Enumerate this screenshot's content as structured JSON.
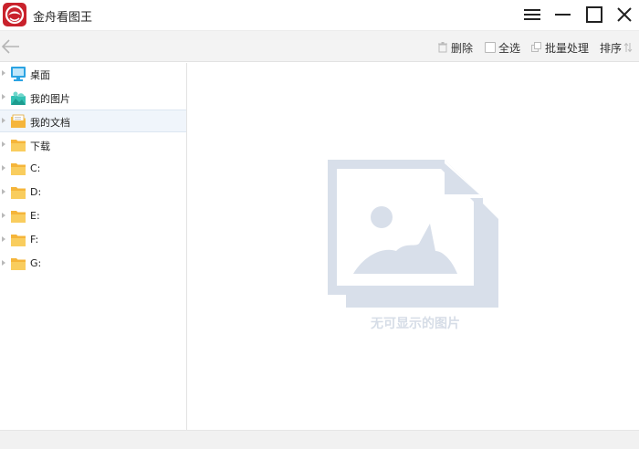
{
  "app": {
    "title": "金舟看图王",
    "logo_icon": "app-logo-icon",
    "accent_color": "#c9222c"
  },
  "window_controls": {
    "menu_icon": "menu-icon",
    "minimize_icon": "minimize-icon",
    "maximize_icon": "maximize-icon",
    "close_icon": "close-icon"
  },
  "toolbar": {
    "back_icon": "arrow-left-icon",
    "delete_label": "删除",
    "select_all_label": "全选",
    "batch_label": "批量处理",
    "sort_label": "排序"
  },
  "sidebar": {
    "items": [
      {
        "label": "桌面",
        "icon": "desktop-icon",
        "selected": false
      },
      {
        "label": "我的图片",
        "icon": "pictures-icon",
        "selected": false
      },
      {
        "label": "我的文档",
        "icon": "documents-icon",
        "selected": true
      },
      {
        "label": "下载",
        "icon": "folder-icon",
        "selected": false
      },
      {
        "label": "C:",
        "icon": "folder-icon",
        "selected": false
      },
      {
        "label": "D:",
        "icon": "folder-icon",
        "selected": false
      },
      {
        "label": "E:",
        "icon": "folder-icon",
        "selected": false
      },
      {
        "label": "F:",
        "icon": "folder-icon",
        "selected": false
      },
      {
        "label": "G:",
        "icon": "folder-icon",
        "selected": false
      }
    ]
  },
  "main": {
    "empty_icon": "empty-image-icon",
    "empty_text": "无可显示的图片"
  },
  "colors": {
    "folder": "#f7c54e",
    "placeholder": "#d6dde7",
    "selection": "#f0f5fb"
  }
}
